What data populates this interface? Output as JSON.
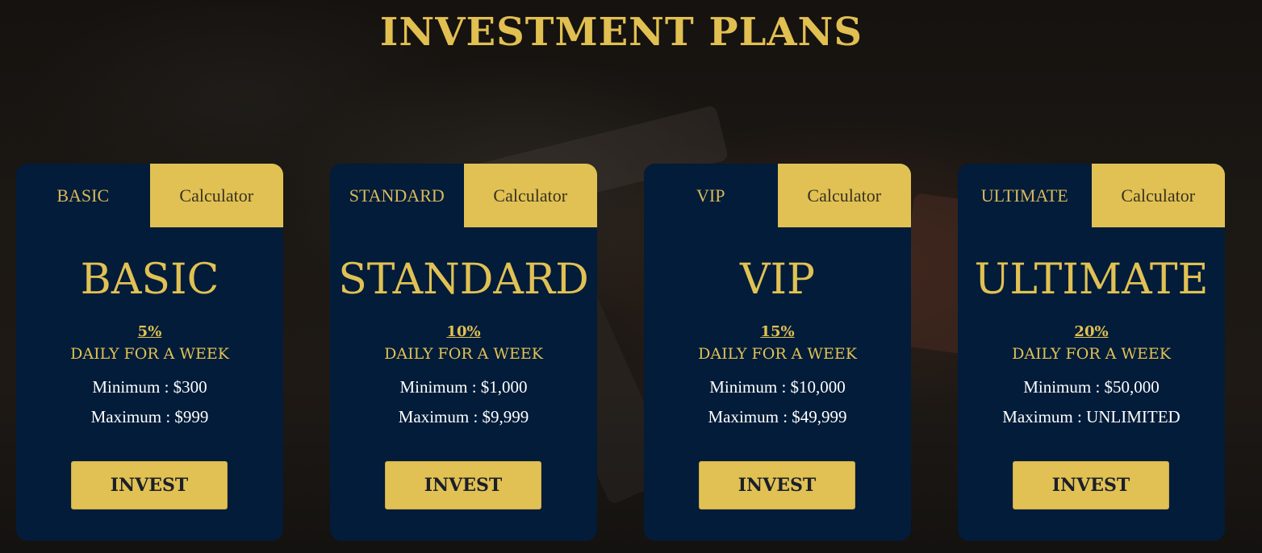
{
  "page": {
    "title": "INVESTMENT PLANS"
  },
  "colors": {
    "accent": "#e1c153",
    "card_background": "#021c39",
    "page_background": "#171410"
  },
  "plans": [
    {
      "tab_label": "BASIC",
      "calculator_label": "Calculator",
      "name": "BASIC",
      "rate": "5%",
      "period": "DAILY FOR A WEEK",
      "minimum": "Minimum : $300",
      "maximum": "Maximum : $999",
      "button_label": "INVEST"
    },
    {
      "tab_label": "STANDARD",
      "calculator_label": "Calculator",
      "name": "STANDARD",
      "rate": "10%",
      "period": "DAILY FOR A WEEK",
      "minimum": "Minimum : $1,000",
      "maximum": "Maximum : $9,999",
      "button_label": "INVEST"
    },
    {
      "tab_label": "VIP",
      "calculator_label": "Calculator",
      "name": "VIP",
      "rate": "15%",
      "period": "DAILY FOR A WEEK",
      "minimum": "Minimum : $10,000",
      "maximum": "Maximum : $49,999",
      "button_label": "INVEST"
    },
    {
      "tab_label": "ULTIMATE",
      "calculator_label": "Calculator",
      "name": "ULTIMATE",
      "rate": "20%",
      "period": "DAILY FOR A WEEK",
      "minimum": "Minimum : $50,000",
      "maximum": "Maximum : UNLIMITED",
      "button_label": "INVEST"
    }
  ]
}
